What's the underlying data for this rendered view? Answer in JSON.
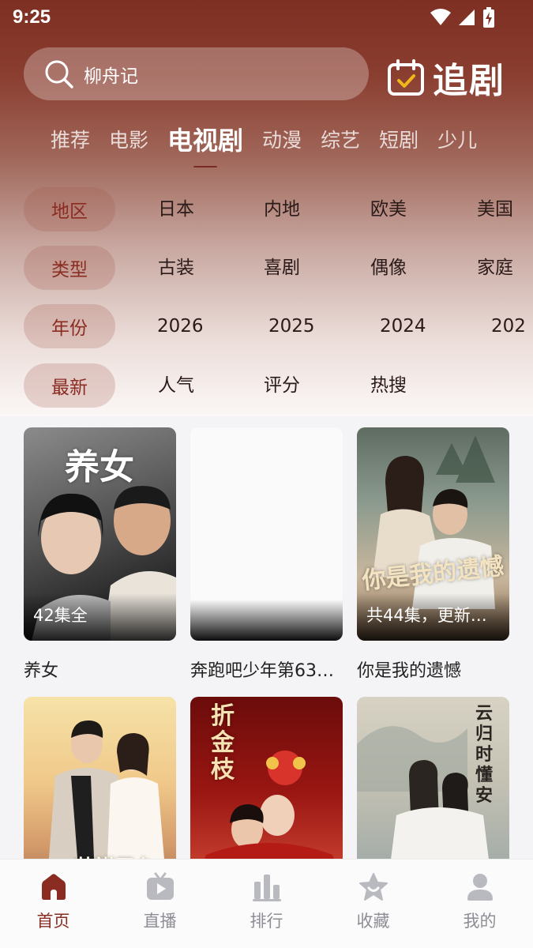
{
  "status_bar": {
    "time": "9:25"
  },
  "search": {
    "query": "柳舟记"
  },
  "header_action": {
    "label": "追剧"
  },
  "tabs": [
    {
      "label": "推荐",
      "active": false
    },
    {
      "label": "电影",
      "active": false
    },
    {
      "label": "电视剧",
      "active": true
    },
    {
      "label": "动漫",
      "active": false
    },
    {
      "label": "综艺",
      "active": false
    },
    {
      "label": "短剧",
      "active": false
    },
    {
      "label": "少儿",
      "active": false
    }
  ],
  "filters": [
    {
      "label": "地区",
      "options": [
        "日本",
        "内地",
        "欧美",
        "美国"
      ]
    },
    {
      "label": "类型",
      "options": [
        "古装",
        "喜剧",
        "偶像",
        "家庭"
      ]
    },
    {
      "label": "年份",
      "options": [
        "2026",
        "2025",
        "2024",
        "202"
      ]
    },
    {
      "label": "最新",
      "options": [
        "人气",
        "评分",
        "热搜"
      ]
    }
  ],
  "items": [
    {
      "title": "养女",
      "badge": "42集全",
      "art_title": "养女",
      "palette": [
        "#6e6e6e",
        "#1c1c1c"
      ]
    },
    {
      "title": "奔跑吧少年第63…",
      "badge": "",
      "art_title": "",
      "palette": [
        "#ffffff",
        "#f2f2f2"
      ]
    },
    {
      "title": "你是我的遗憾",
      "badge": "共44集，更新…",
      "art_title": "你是我的遗憾",
      "palette": [
        "#7f8a84",
        "#c6b49a"
      ]
    },
    {
      "title": "",
      "badge": "",
      "art_title": "芸祺已久",
      "palette": [
        "#f3d28e",
        "#c9a27a"
      ]
    },
    {
      "title": "",
      "badge": "",
      "art_title": "折金枝",
      "palette": [
        "#8a1410",
        "#c0392b"
      ]
    },
    {
      "title": "",
      "badge": "",
      "art_title": "云归时懂安",
      "palette": [
        "#c9c4b4",
        "#9aa3a0"
      ]
    }
  ],
  "bottom_nav": [
    {
      "label": "首页",
      "icon": "home-icon",
      "active": true
    },
    {
      "label": "直播",
      "icon": "live-tv-icon",
      "active": false
    },
    {
      "label": "排行",
      "icon": "ranking-bars-icon",
      "active": false
    },
    {
      "label": "收藏",
      "icon": "favorite-star-icon",
      "active": false
    },
    {
      "label": "我的",
      "icon": "profile-icon",
      "active": false
    }
  ],
  "colors": {
    "brand": "#7d2f22",
    "accent": "#8b2c22",
    "nav_inactive": "#8d8d95"
  }
}
